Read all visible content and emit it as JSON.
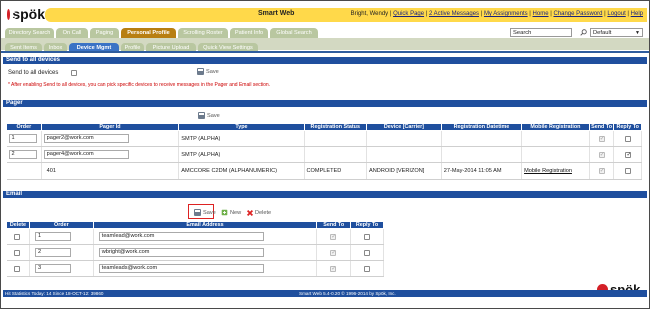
{
  "app": {
    "logo_text": "spök",
    "title": "Smart Web"
  },
  "header": {
    "user_name": "Bright, Wendy",
    "links": [
      "Quick Page",
      "2 Active Messages",
      "My Assignments",
      "Home",
      "Change Password",
      "Logout",
      "Help"
    ]
  },
  "main_tabs": [
    "Directory Search",
    "On Call",
    "Paging",
    "Personal Profile",
    "Scrolling Roster",
    "Patient Info",
    "Global Search"
  ],
  "main_tabs_active": "Personal Profile",
  "search": {
    "value": "Search",
    "profile_select": "Default"
  },
  "sub_tabs": [
    "Sent Items",
    "Inbox",
    "Device Mgmt",
    "Profile",
    "Picture Upload",
    "Quick View Settings"
  ],
  "sub_tabs_active": "Device Mgmt",
  "send_all": {
    "header": "Send to all devices",
    "label": "Send to all devices",
    "save_label": "Save",
    "note": "* After enabling Send to all devices, you can pick specific devices to receive messages in the Pager and Email section."
  },
  "pager": {
    "header": "Pager",
    "save_label": "Save",
    "columns": [
      "Order",
      "Pager Id",
      "Type",
      "Registration Status",
      "Device [Carrier]",
      "Registration Datetime",
      "Mobile Registration",
      "Send To",
      "Reply To"
    ],
    "rows": [
      {
        "order": "1",
        "pager_id": "pager2@work.com",
        "type": "SMTP (ALPHA)",
        "status": "",
        "device": "",
        "datetime": "",
        "mobile": "",
        "send_to": true,
        "reply_to": false
      },
      {
        "order": "2",
        "pager_id": "pager4@work.com",
        "type": "SMTP (ALPHA)",
        "status": "",
        "device": "",
        "datetime": "",
        "mobile": "",
        "send_to": true,
        "reply_to": true
      },
      {
        "order": "",
        "pager_id": "401",
        "type": "AMCCORE C2DM (ALPHANUMERIC)",
        "status": "COMPLETED",
        "device": "ANDROID [VERIZON]",
        "datetime": "27-May-2014 11:05 AM",
        "mobile": "Mobile Registration",
        "send_to": true,
        "reply_to": false
      }
    ]
  },
  "email": {
    "header": "Email",
    "save_label": "Save",
    "new_label": "New",
    "delete_label": "Delete",
    "columns": [
      "Delete",
      "Order",
      "Email Address",
      "Send To",
      "Reply To"
    ],
    "rows": [
      {
        "order": "1",
        "address": "teamlead@work.com",
        "send_to": true,
        "reply_to": false
      },
      {
        "order": "2",
        "address": "wbright@work.com",
        "send_to": true,
        "reply_to": false
      },
      {
        "order": "3",
        "address": "teamleads@work.com",
        "send_to": true,
        "reply_to": false
      }
    ]
  },
  "footer": {
    "stats": "Hit Statistics Today: 14 Since 18-OCT-12: 39860",
    "copyright": "Smart Web 5.4-0.20 © 1996-2014 by Spök, Inc.",
    "logo_text": "spök"
  },
  "colors": {
    "brand_yellow": "#ffd94a",
    "header_blue": "#1f4f9e",
    "active_tab": "#b87f12",
    "brand_red": "#d42027"
  }
}
